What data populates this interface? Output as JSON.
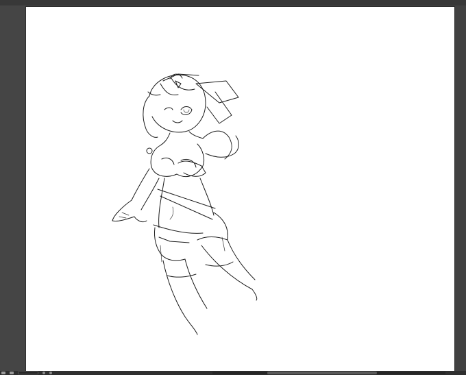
{
  "app": {
    "background_color": "#404040",
    "canvas_color": "#ffffff",
    "line_color": "#1a1a1a"
  },
  "canvas": {
    "content": "line-art-sketch",
    "artwork_icon": "sketch-figure"
  },
  "status_bar": {
    "icons": [
      "navigator-icon",
      "zoom-icon",
      "rotate-icon",
      "flip-icon"
    ]
  }
}
